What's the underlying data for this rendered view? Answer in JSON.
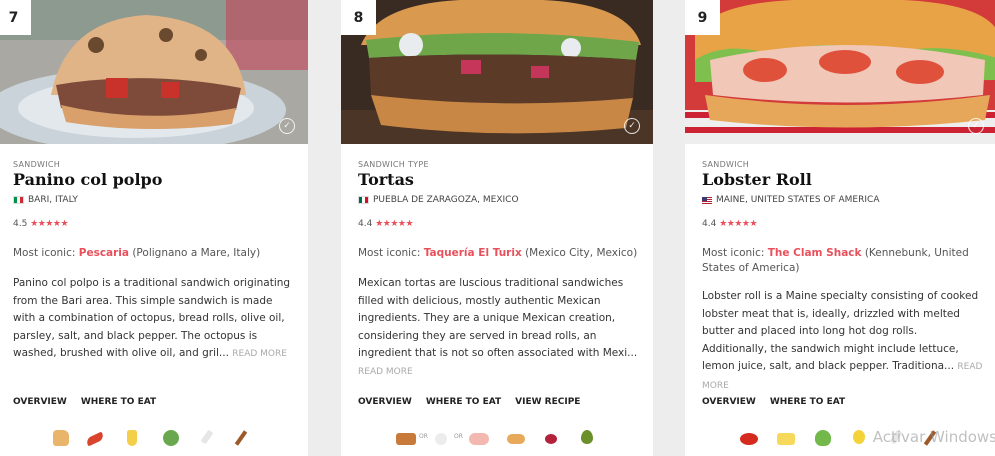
{
  "cards": [
    {
      "rank": "7",
      "type": "SANDWICH",
      "name": "Panino col polpo",
      "location": "BARI, ITALY",
      "rating": "4.5",
      "stars": "★★★★★",
      "iconic_prefix": "Most iconic: ",
      "iconic_place": "Pescaria",
      "iconic_suffix": " (Polignano a Mare, Italy)",
      "description": "Panino col polpo is a traditional sandwich originating from the Bari area. This simple sandwich is made with a combination of octopus, bread rolls, olive oil, parsley, salt, and black pepper. The octopus is washed, brushed with olive oil, and gril...",
      "read_more": "READ MORE",
      "links": [
        "OVERVIEW",
        "WHERE TO EAT"
      ],
      "ingredients": [
        "bread-icon",
        "octopus-icon",
        "olive-oil-icon",
        "parsley-icon",
        "salt-icon",
        "black-pepper-icon"
      ]
    },
    {
      "rank": "8",
      "type": "SANDWICH TYPE",
      "name": "Tortas",
      "location": "PUEBLA DE ZARAGOZA, MEXICO",
      "rating": "4.4",
      "stars": "★★★★★",
      "iconic_prefix": "Most iconic: ",
      "iconic_place": "Taquería El Turix",
      "iconic_suffix": " (Mexico City, Mexico)",
      "description": "Mexican tortas are luscious traditional sandwiches filled with delicious, mostly authentic Mexican ingredients. They are a unique Mexican creation, considering they are served in bread rolls, an ingredient that is not so often associated with Mexi...",
      "read_more": "READ MORE",
      "links": [
        "OVERVIEW",
        "WHERE TO EAT",
        "VIEW RECIPE"
      ],
      "or_label": "OR",
      "ingredients": [
        "beef-icon",
        "chicken-icon",
        "pork-icon",
        "bread-roll-icon",
        "beans-icon",
        "avocado-icon"
      ]
    },
    {
      "rank": "9",
      "type": "SANDWICH",
      "name": "Lobster Roll",
      "location": "MAINE, UNITED STATES OF AMERICA",
      "rating": "4.4",
      "stars": "★★★★★",
      "iconic_prefix": "Most iconic: ",
      "iconic_place": "The Clam Shack",
      "iconic_suffix": " (Kennebunk, United States of America)",
      "description": "Lobster roll is a Maine specialty consisting of cooked lobster meat that is, ideally, drizzled with melted butter and placed into long hot dog rolls. Additionally, the sandwich might include lettuce, lemon juice, salt, and black pepper. Traditiona...",
      "read_more": "READ MORE",
      "links": [
        "OVERVIEW",
        "WHERE TO EAT"
      ],
      "ingredients": [
        "lobster-icon",
        "butter-icon",
        "lettuce-icon",
        "lemon-icon",
        "salt-icon",
        "black-pepper-icon"
      ]
    }
  ],
  "watermark": "Activar Windows"
}
